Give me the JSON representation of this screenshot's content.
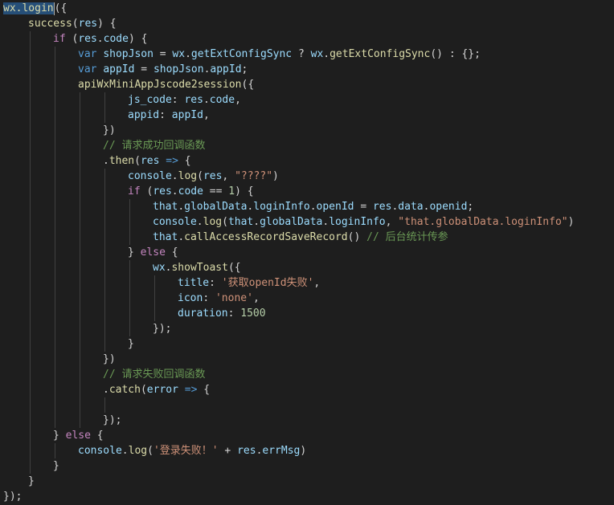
{
  "editor": {
    "language": "javascript",
    "theme": "dark",
    "colors": {
      "background": "#1e1e1e",
      "plain": "#d4d4d4",
      "variable": "#9cdcfe",
      "function": "#dcdcaa",
      "keyword": "#569cd6",
      "control": "#c586c0",
      "string": "#ce9178",
      "number": "#b5cea8",
      "comment": "#6a9955",
      "selection": "#264f78"
    },
    "lines": [
      {
        "indent": 0,
        "tokens": [
          [
            "sel",
            "wx.login"
          ],
          [
            "cursor",
            ""
          ],
          [
            "plain",
            "({"
          ]
        ]
      },
      {
        "indent": 1,
        "tokens": [
          [
            "fn",
            "success"
          ],
          [
            "plain",
            "("
          ],
          [
            "var",
            "res"
          ],
          [
            "plain",
            ") {"
          ]
        ]
      },
      {
        "indent": 2,
        "tokens": [
          [
            "ctl",
            "if"
          ],
          [
            "plain",
            " ("
          ],
          [
            "var",
            "res"
          ],
          [
            "plain",
            "."
          ],
          [
            "var",
            "code"
          ],
          [
            "plain",
            ") {"
          ]
        ]
      },
      {
        "indent": 3,
        "tokens": [
          [
            "kw",
            "var"
          ],
          [
            "plain",
            " "
          ],
          [
            "var",
            "shopJson"
          ],
          [
            "plain",
            " = "
          ],
          [
            "var",
            "wx"
          ],
          [
            "plain",
            "."
          ],
          [
            "var",
            "getExtConfigSync"
          ],
          [
            "plain",
            " ? "
          ],
          [
            "var",
            "wx"
          ],
          [
            "plain",
            "."
          ],
          [
            "fn",
            "getExtConfigSync"
          ],
          [
            "plain",
            "() : {};"
          ]
        ]
      },
      {
        "indent": 3,
        "tokens": [
          [
            "kw",
            "var"
          ],
          [
            "plain",
            " "
          ],
          [
            "var",
            "appId"
          ],
          [
            "plain",
            " = "
          ],
          [
            "var",
            "shopJson"
          ],
          [
            "plain",
            "."
          ],
          [
            "var",
            "appId"
          ],
          [
            "plain",
            ";"
          ]
        ]
      },
      {
        "indent": 3,
        "tokens": [
          [
            "fn",
            "apiWxMiniAppJscode2session"
          ],
          [
            "plain",
            "({"
          ]
        ]
      },
      {
        "indent": 5,
        "tokens": [
          [
            "var",
            "js_code"
          ],
          [
            "plain",
            ": "
          ],
          [
            "var",
            "res"
          ],
          [
            "plain",
            "."
          ],
          [
            "var",
            "code"
          ],
          [
            "plain",
            ","
          ]
        ]
      },
      {
        "indent": 5,
        "tokens": [
          [
            "var",
            "appid"
          ],
          [
            "plain",
            ": "
          ],
          [
            "var",
            "appId"
          ],
          [
            "plain",
            ","
          ]
        ]
      },
      {
        "indent": 4,
        "tokens": [
          [
            "plain",
            "})"
          ]
        ]
      },
      {
        "indent": 4,
        "tokens": [
          [
            "cmt",
            "// 请求成功回调函数"
          ]
        ]
      },
      {
        "indent": 4,
        "tokens": [
          [
            "plain",
            "."
          ],
          [
            "fn",
            "then"
          ],
          [
            "plain",
            "("
          ],
          [
            "var",
            "res"
          ],
          [
            "plain",
            " "
          ],
          [
            "kw",
            "=>"
          ],
          [
            "plain",
            " {"
          ]
        ]
      },
      {
        "indent": 5,
        "tokens": [
          [
            "var",
            "console"
          ],
          [
            "plain",
            "."
          ],
          [
            "fn",
            "log"
          ],
          [
            "plain",
            "("
          ],
          [
            "var",
            "res"
          ],
          [
            "plain",
            ", "
          ],
          [
            "str",
            "\"????\""
          ],
          [
            "plain",
            ")"
          ]
        ]
      },
      {
        "indent": 5,
        "tokens": [
          [
            "ctl",
            "if"
          ],
          [
            "plain",
            " ("
          ],
          [
            "var",
            "res"
          ],
          [
            "plain",
            "."
          ],
          [
            "var",
            "code"
          ],
          [
            "plain",
            " == "
          ],
          [
            "num",
            "1"
          ],
          [
            "plain",
            ") {"
          ]
        ]
      },
      {
        "indent": 6,
        "tokens": [
          [
            "var",
            "that"
          ],
          [
            "plain",
            "."
          ],
          [
            "var",
            "globalData"
          ],
          [
            "plain",
            "."
          ],
          [
            "var",
            "loginInfo"
          ],
          [
            "plain",
            "."
          ],
          [
            "var",
            "openId"
          ],
          [
            "plain",
            " = "
          ],
          [
            "var",
            "res"
          ],
          [
            "plain",
            "."
          ],
          [
            "var",
            "data"
          ],
          [
            "plain",
            "."
          ],
          [
            "var",
            "openid"
          ],
          [
            "plain",
            ";"
          ]
        ]
      },
      {
        "indent": 6,
        "tokens": [
          [
            "var",
            "console"
          ],
          [
            "plain",
            "."
          ],
          [
            "fn",
            "log"
          ],
          [
            "plain",
            "("
          ],
          [
            "var",
            "that"
          ],
          [
            "plain",
            "."
          ],
          [
            "var",
            "globalData"
          ],
          [
            "plain",
            "."
          ],
          [
            "var",
            "loginInfo"
          ],
          [
            "plain",
            ", "
          ],
          [
            "str",
            "\"that.globalData.loginInfo\""
          ],
          [
            "plain",
            ")"
          ]
        ]
      },
      {
        "indent": 6,
        "tokens": [
          [
            "var",
            "that"
          ],
          [
            "plain",
            "."
          ],
          [
            "fn",
            "callAccessRecordSaveRecord"
          ],
          [
            "plain",
            "() "
          ],
          [
            "cmt",
            "// 后台统计传参"
          ]
        ]
      },
      {
        "indent": 5,
        "tokens": [
          [
            "plain",
            "} "
          ],
          [
            "ctl",
            "else"
          ],
          [
            "plain",
            " {"
          ]
        ]
      },
      {
        "indent": 6,
        "tokens": [
          [
            "var",
            "wx"
          ],
          [
            "plain",
            "."
          ],
          [
            "fn",
            "showToast"
          ],
          [
            "plain",
            "({"
          ]
        ]
      },
      {
        "indent": 7,
        "tokens": [
          [
            "var",
            "title"
          ],
          [
            "plain",
            ": "
          ],
          [
            "str",
            "'获取openId失败'"
          ],
          [
            "plain",
            ","
          ]
        ]
      },
      {
        "indent": 7,
        "tokens": [
          [
            "var",
            "icon"
          ],
          [
            "plain",
            ": "
          ],
          [
            "str",
            "'none'"
          ],
          [
            "plain",
            ","
          ]
        ]
      },
      {
        "indent": 7,
        "tokens": [
          [
            "var",
            "duration"
          ],
          [
            "plain",
            ": "
          ],
          [
            "num",
            "1500"
          ]
        ]
      },
      {
        "indent": 6,
        "tokens": [
          [
            "plain",
            "});"
          ]
        ]
      },
      {
        "indent": 5,
        "tokens": [
          [
            "plain",
            "}"
          ]
        ]
      },
      {
        "indent": 4,
        "tokens": [
          [
            "plain",
            "})"
          ]
        ]
      },
      {
        "indent": 4,
        "tokens": [
          [
            "cmt",
            "// 请求失败回调函数"
          ]
        ]
      },
      {
        "indent": 4,
        "tokens": [
          [
            "plain",
            "."
          ],
          [
            "fn",
            "catch"
          ],
          [
            "plain",
            "("
          ],
          [
            "var",
            "error"
          ],
          [
            "plain",
            " "
          ],
          [
            "kw",
            "=>"
          ],
          [
            "plain",
            " {"
          ]
        ]
      },
      {
        "indent": 0,
        "tokens": []
      },
      {
        "indent": 4,
        "tokens": [
          [
            "plain",
            "});"
          ]
        ]
      },
      {
        "indent": 2,
        "tokens": [
          [
            "plain",
            "} "
          ],
          [
            "ctl",
            "else"
          ],
          [
            "plain",
            " {"
          ]
        ]
      },
      {
        "indent": 3,
        "tokens": [
          [
            "var",
            "console"
          ],
          [
            "plain",
            "."
          ],
          [
            "fn",
            "log"
          ],
          [
            "plain",
            "("
          ],
          [
            "str",
            "'登录失败！'"
          ],
          [
            "plain",
            " + "
          ],
          [
            "var",
            "res"
          ],
          [
            "plain",
            "."
          ],
          [
            "var",
            "errMsg"
          ],
          [
            "plain",
            ")"
          ]
        ]
      },
      {
        "indent": 2,
        "tokens": [
          [
            "plain",
            "}"
          ]
        ]
      },
      {
        "indent": 1,
        "tokens": [
          [
            "plain",
            "}"
          ]
        ]
      },
      {
        "indent": 0,
        "tokens": [
          [
            "plain",
            "});"
          ]
        ]
      }
    ]
  }
}
